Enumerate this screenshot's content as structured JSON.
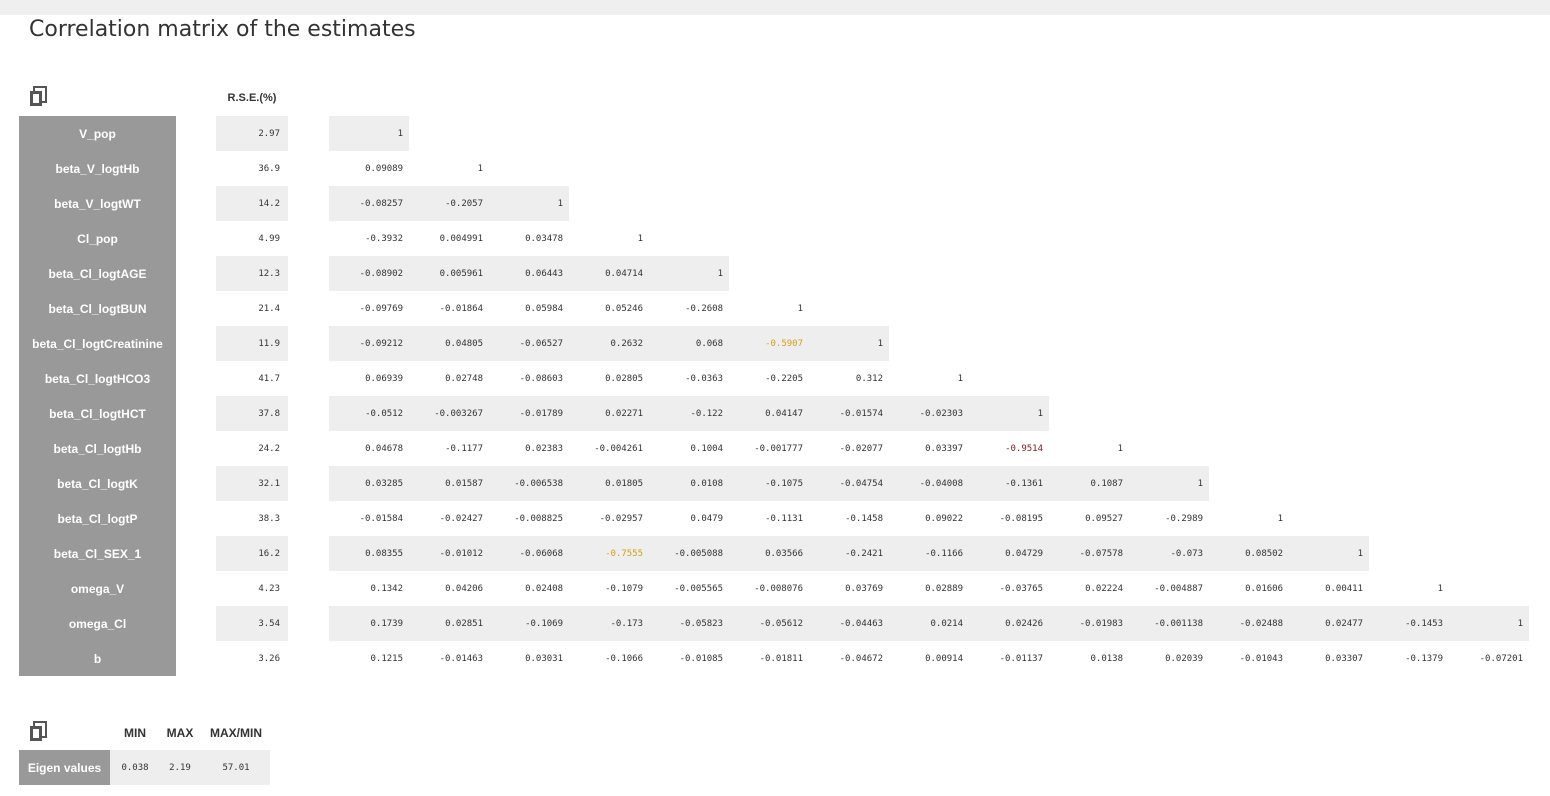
{
  "title": "Correlation matrix of the estimates",
  "rse_header": "R.S.E.(%)",
  "params": [
    "V_pop",
    "beta_V_logtHb",
    "beta_V_logtWT",
    "Cl_pop",
    "beta_Cl_logtAGE",
    "beta_Cl_logtBUN",
    "beta_Cl_logtCreatinine",
    "beta_Cl_logtHCO3",
    "beta_Cl_logtHCT",
    "beta_Cl_logtHb",
    "beta_Cl_logtK",
    "beta_Cl_logtP",
    "beta_Cl_SEX_1",
    "omega_V",
    "omega_Cl",
    "b"
  ],
  "rse": [
    "2.97",
    "36.9",
    "14.2",
    "4.99",
    "12.3",
    "21.4",
    "11.9",
    "41.7",
    "37.8",
    "24.2",
    "32.1",
    "38.3",
    "16.2",
    "4.23",
    "3.54",
    "3.26"
  ],
  "matrix": [
    [
      "1"
    ],
    [
      "0.09089",
      "1"
    ],
    [
      "-0.08257",
      "-0.2057",
      "1"
    ],
    [
      "-0.3932",
      "0.004991",
      "0.03478",
      "1"
    ],
    [
      "-0.08902",
      "0.005961",
      "0.06443",
      "0.04714",
      "1"
    ],
    [
      "-0.09769",
      "-0.01864",
      "0.05984",
      "0.05246",
      "-0.2608",
      "1"
    ],
    [
      "-0.09212",
      "0.04805",
      "-0.06527",
      "0.2632",
      "0.068",
      "-0.5907",
      "1"
    ],
    [
      "0.06939",
      "0.02748",
      "-0.08603",
      "0.02805",
      "-0.0363",
      "-0.2205",
      "0.312",
      "1"
    ],
    [
      "-0.0512",
      "-0.003267",
      "-0.01789",
      "0.02271",
      "-0.122",
      "0.04147",
      "-0.01574",
      "-0.02303",
      "1"
    ],
    [
      "0.04678",
      "-0.1177",
      "0.02383",
      "-0.004261",
      "0.1004",
      "-0.001777",
      "-0.02077",
      "0.03397",
      "-0.9514",
      "1"
    ],
    [
      "0.03285",
      "0.01587",
      "-0.006538",
      "0.01805",
      "0.0108",
      "-0.1075",
      "-0.04754",
      "-0.04008",
      "-0.1361",
      "0.1087",
      "1"
    ],
    [
      "-0.01584",
      "-0.02427",
      "-0.008825",
      "-0.02957",
      "0.0479",
      "-0.1131",
      "-0.1458",
      "0.09022",
      "-0.08195",
      "0.09527",
      "-0.2989",
      "1"
    ],
    [
      "0.08355",
      "-0.01012",
      "-0.06068",
      "-0.7555",
      "-0.005088",
      "0.03566",
      "-0.2421",
      "-0.1166",
      "0.04729",
      "-0.07578",
      "-0.073",
      "0.08502",
      "1"
    ],
    [
      "0.1342",
      "0.04206",
      "0.02408",
      "-0.1079",
      "-0.005565",
      "-0.008076",
      "0.03769",
      "0.02889",
      "-0.03765",
      "0.02224",
      "-0.004887",
      "0.01606",
      "0.00411",
      "1"
    ],
    [
      "0.1739",
      "0.02851",
      "-0.1069",
      "-0.173",
      "-0.05823",
      "-0.05612",
      "-0.04463",
      "0.0214",
      "0.02426",
      "-0.01983",
      "-0.001138",
      "-0.02488",
      "0.02477",
      "-0.1453",
      "1"
    ],
    [
      "0.1215",
      "-0.01463",
      "0.03031",
      "-0.1066",
      "-0.01085",
      "-0.01811",
      "-0.04672",
      "0.00914",
      "-0.01137",
      "0.0138",
      "0.02039",
      "-0.01043",
      "0.03307",
      "-0.1379",
      "-0.07201"
    ]
  ],
  "highlights": [
    {
      "row": 6,
      "col": 5,
      "color": "#d4a017"
    },
    {
      "row": 9,
      "col": 8,
      "color": "#7a1a1a"
    },
    {
      "row": 12,
      "col": 3,
      "color": "#d4a017"
    }
  ],
  "eigen": {
    "label": "Eigen values",
    "headers": [
      "MIN",
      "MAX",
      "MAX/MIN"
    ],
    "values": [
      "0.038",
      "2.19",
      "57.01"
    ]
  },
  "icons": {
    "copy": "copy-icon"
  }
}
